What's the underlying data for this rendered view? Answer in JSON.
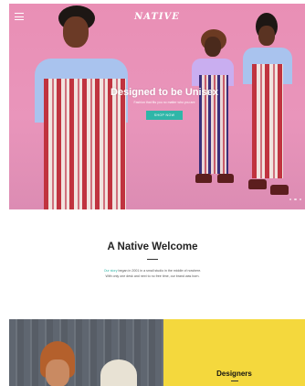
{
  "header": {
    "logo_text": "NATIVE",
    "menu_icon": "hamburger-menu-icon"
  },
  "hero": {
    "title": "Designed to be Unisex",
    "subtitle": "Fashion that fits you no matter who you are",
    "button_label": "SHOP NOW",
    "slide_dots": 3,
    "colors": {
      "background": "#e98fb5",
      "button": "#2fb6a8"
    }
  },
  "welcome": {
    "title": "A Native Welcome",
    "line1_link": "Our story",
    "line1_rest": " began in 2001 in a small studio in the middle of nowhere.",
    "line2": "With only one desk and next to no free time, our brand was born."
  },
  "features": {
    "designers_label": "Designers",
    "colors": {
      "designers_bg": "#f4d83d"
    }
  }
}
